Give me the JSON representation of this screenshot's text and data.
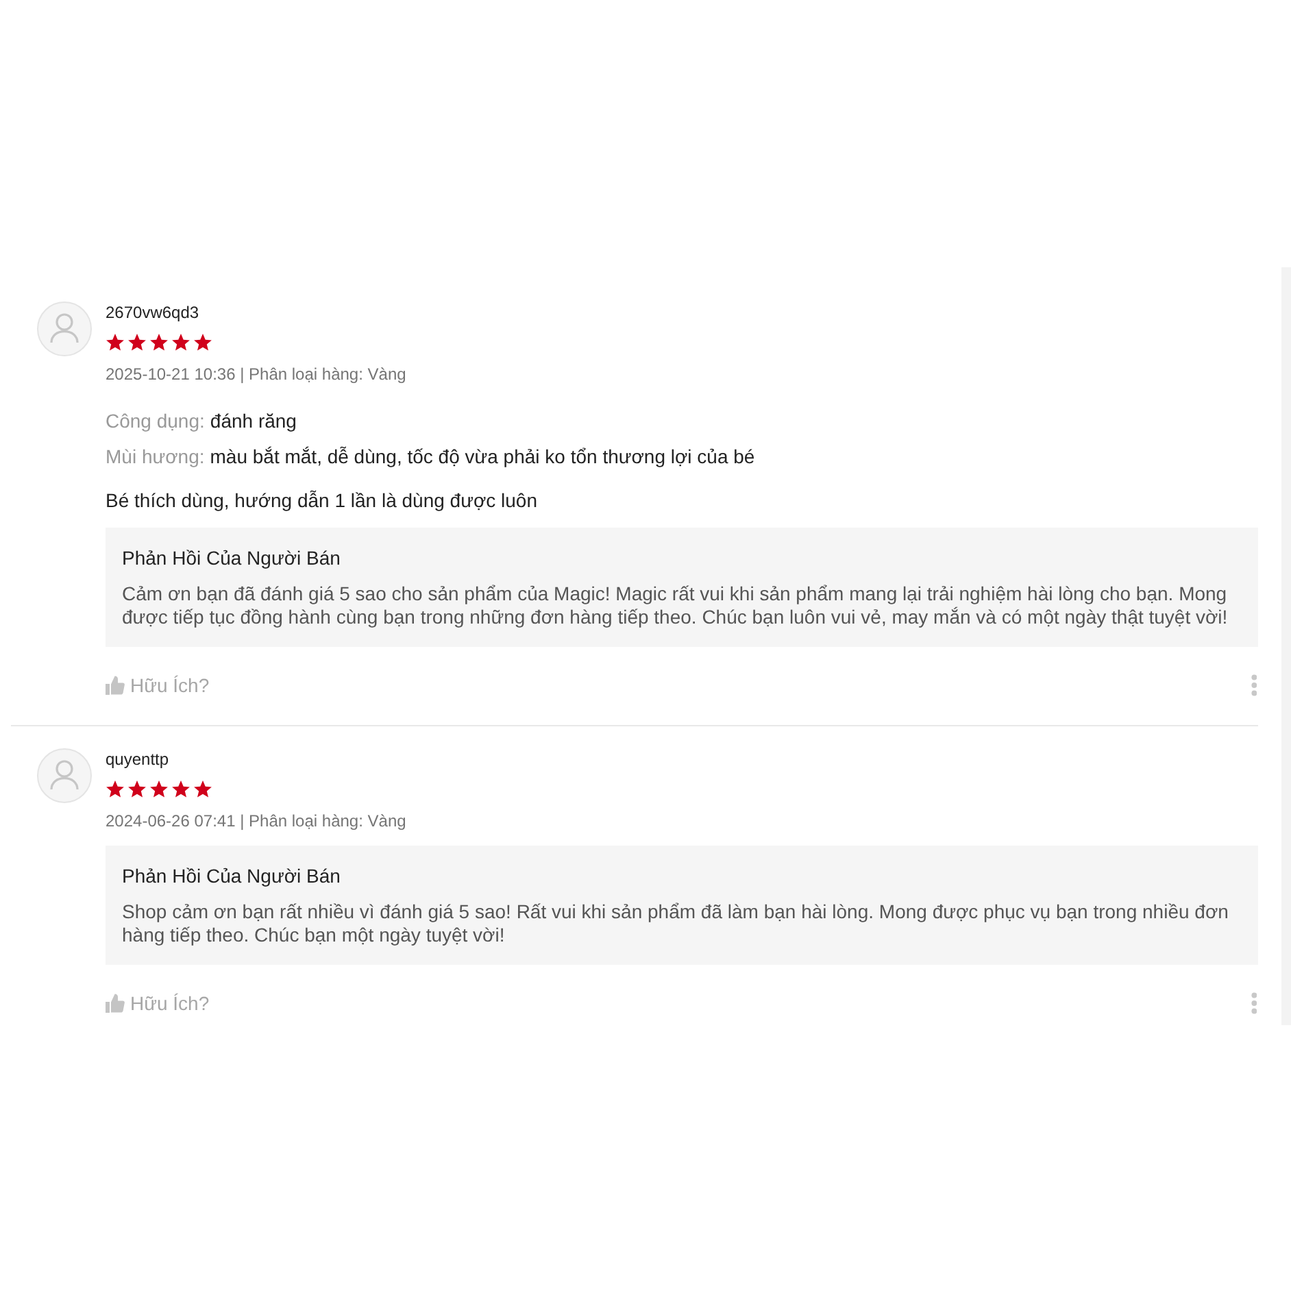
{
  "reviews": [
    {
      "username": "2670vw6qd3",
      "stars": 5,
      "meta": "2025-10-21 10:36 | Phân loại hàng: Vàng",
      "attributes": [
        {
          "label": "Công dụng:",
          "value": "đánh răng"
        },
        {
          "label": "Mùi hương:",
          "value": "màu bắt mắt, dễ dùng, tốc độ vừa phải ko tổn thương lợi của bé"
        }
      ],
      "comment": "Bé thích dùng, hướng dẫn 1 lần là dùng được luôn",
      "reply": {
        "title": "Phản Hồi Của Người Bán",
        "text": "Cảm ơn bạn đã đánh giá 5 sao cho sản phẩm của Magic! Magic rất vui khi sản phẩm mang lại trải nghiệm hài lòng cho bạn. Mong được tiếp tục đồng hành cùng bạn trong những đơn hàng tiếp theo. Chúc bạn luôn vui vẻ, may mắn và có một ngày thật tuyệt vời!"
      },
      "helpful": "Hữu Ích?"
    },
    {
      "username": "quyenttp",
      "stars": 5,
      "meta": "2024-06-26 07:41 | Phân loại hàng: Vàng",
      "reply": {
        "title": "Phản Hồi Của Người Bán",
        "text": "Shop cảm ơn bạn rất nhiều vì đánh giá 5 sao! Rất vui khi sản phẩm đã làm bạn hài lòng. Mong được phục vụ bạn trong nhiều đơn hàng tiếp theo. Chúc bạn một ngày tuyệt vời!"
      },
      "helpful": "Hữu Ích?"
    }
  ]
}
